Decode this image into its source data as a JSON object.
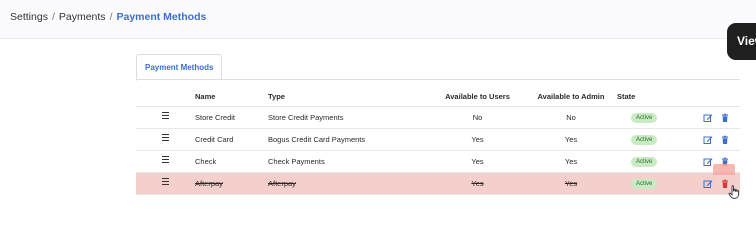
{
  "breadcrumb": {
    "items": [
      "Settings",
      "Payments",
      "Payment Methods"
    ],
    "separator": "/"
  },
  "tooltip": {
    "text": "View"
  },
  "tabs": [
    {
      "label": "Payment Methods",
      "active": true
    }
  ],
  "table": {
    "columns": {
      "name": "Name",
      "type": "Type",
      "available_users": "Available to Users",
      "available_admin": "Available to Admin",
      "state": "State"
    },
    "rows": [
      {
        "name": "Store Credit",
        "type": "Store Credit Payments",
        "users": "No",
        "admin": "No",
        "state": "Active"
      },
      {
        "name": "Credit Card",
        "type": "Bogus Credit Card Payments",
        "users": "Yes",
        "admin": "Yes",
        "state": "Active"
      },
      {
        "name": "Check",
        "type": "Check Payments",
        "users": "Yes",
        "admin": "Yes",
        "state": "Active"
      },
      {
        "name": "Afterpay",
        "type": "Afterpay",
        "users": "Yes",
        "admin": "Yes",
        "state": "Active",
        "pending_delete": true
      }
    ]
  },
  "icons": {
    "row_handle": "drag-handle-icon",
    "edit": "edit-icon",
    "delete": "trash-icon",
    "cursor": "hand-pointer-icon"
  },
  "colors": {
    "accent": "#3b6fd1",
    "active_badge_bg": "#c9ebc3",
    "active_badge_text": "#2f6b2b",
    "delete_row_bg": "#f4cfcb",
    "delete_icon": "#d83a34"
  }
}
